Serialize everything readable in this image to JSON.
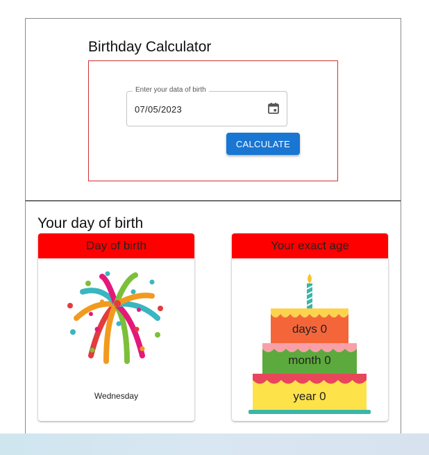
{
  "app": {
    "title": "Birthday Calculator"
  },
  "form": {
    "date_label": "Enter your data of birth",
    "date_value": "07/05/2023",
    "calculate_label": "CALCULATE"
  },
  "results": {
    "section_title": "Your day of birth",
    "day_card": {
      "title": "Day of birth",
      "weekday": "Wednesday"
    },
    "age_card": {
      "title": "Your exact age",
      "days": "days 0",
      "month": "month 0",
      "year": "year 0"
    }
  },
  "colors": {
    "accent": "#1976d2",
    "card_header": "#ff0000",
    "form_border": "#d32f2f"
  },
  "icons": {
    "date_picker": "calendar-icon",
    "day_image": "fireworks-icon",
    "age_image": "birthday-cake-icon"
  }
}
